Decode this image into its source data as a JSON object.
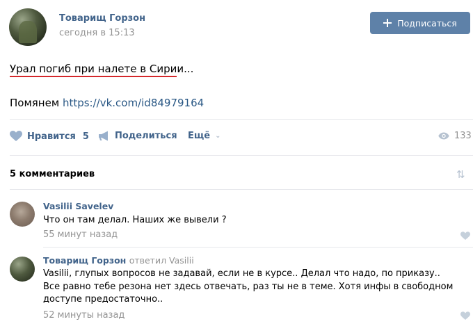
{
  "post": {
    "author": "Товарищ Горзон",
    "time": "сегодня в 15:13",
    "subscribe_label": "Подписаться",
    "text_line1": "Урал погиб при налете в Сирии...",
    "text_line2_prefix": "Помянем",
    "link": "https://vk.com/id84979164"
  },
  "actions": {
    "like_label": "Нравится",
    "like_count": "5",
    "share_label": "Поделиться",
    "more_label": "Ещё",
    "views": "133"
  },
  "comments": {
    "title": "5 комментариев",
    "items": [
      {
        "author": "Vasilii Savelev",
        "reply": "",
        "text": "Что он там делал. Наших же вывели ?",
        "time": "55 минут назад"
      },
      {
        "author": "Товарищ Горзон",
        "reply": "ответил Vasilii",
        "text": "Vasilii, глупых вопросов не задавай, если не в курсе.. Делал что надо, по приказу.. Все равно тебе резона нет здесь отвечать, раз ты не в теме. Хотя инфы в свободном доступе предостаточно..",
        "time": "52 минуты назад"
      }
    ]
  },
  "colors": {
    "link": "#42648b",
    "button": "#5e81a8",
    "muted": "#939393",
    "underline": "#d4272b"
  }
}
